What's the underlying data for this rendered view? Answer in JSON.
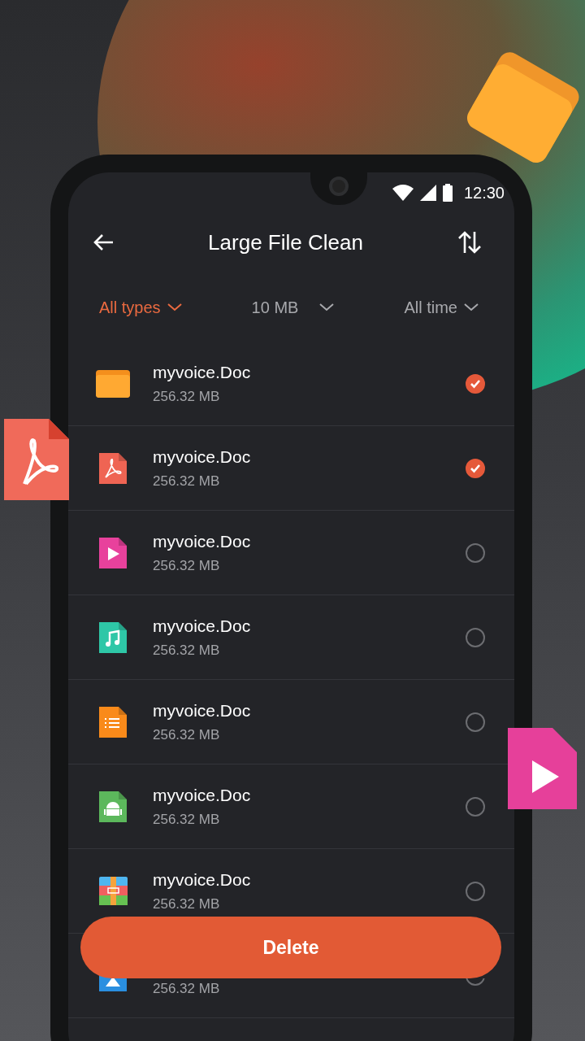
{
  "status_bar": {
    "time": "12:30"
  },
  "header": {
    "title": "Large File Clean"
  },
  "filters": [
    {
      "label": "All types",
      "selected": true
    },
    {
      "label": "10 MB",
      "selected": false
    },
    {
      "label": "All time",
      "selected": false
    }
  ],
  "files": [
    {
      "kind": "folder",
      "name": "myvoice.Doc",
      "size": "256.32 MB",
      "checked": true
    },
    {
      "kind": "pdf",
      "name": "myvoice.Doc",
      "size": "256.32 MB",
      "checked": true
    },
    {
      "kind": "video",
      "name": "myvoice.Doc",
      "size": "256.32 MB",
      "checked": false
    },
    {
      "kind": "audio",
      "name": "myvoice.Doc",
      "size": "256.32 MB",
      "checked": false
    },
    {
      "kind": "list",
      "name": "myvoice.Doc",
      "size": "256.32 MB",
      "checked": false
    },
    {
      "kind": "apk",
      "name": "myvoice.Doc",
      "size": "256.32 MB",
      "checked": false
    },
    {
      "kind": "archive",
      "name": "myvoice.Doc",
      "size": "256.32 MB",
      "checked": false
    },
    {
      "kind": "image",
      "size": "256.32 MB",
      "checked": false
    }
  ],
  "delete_button": {
    "label": "Delete"
  }
}
